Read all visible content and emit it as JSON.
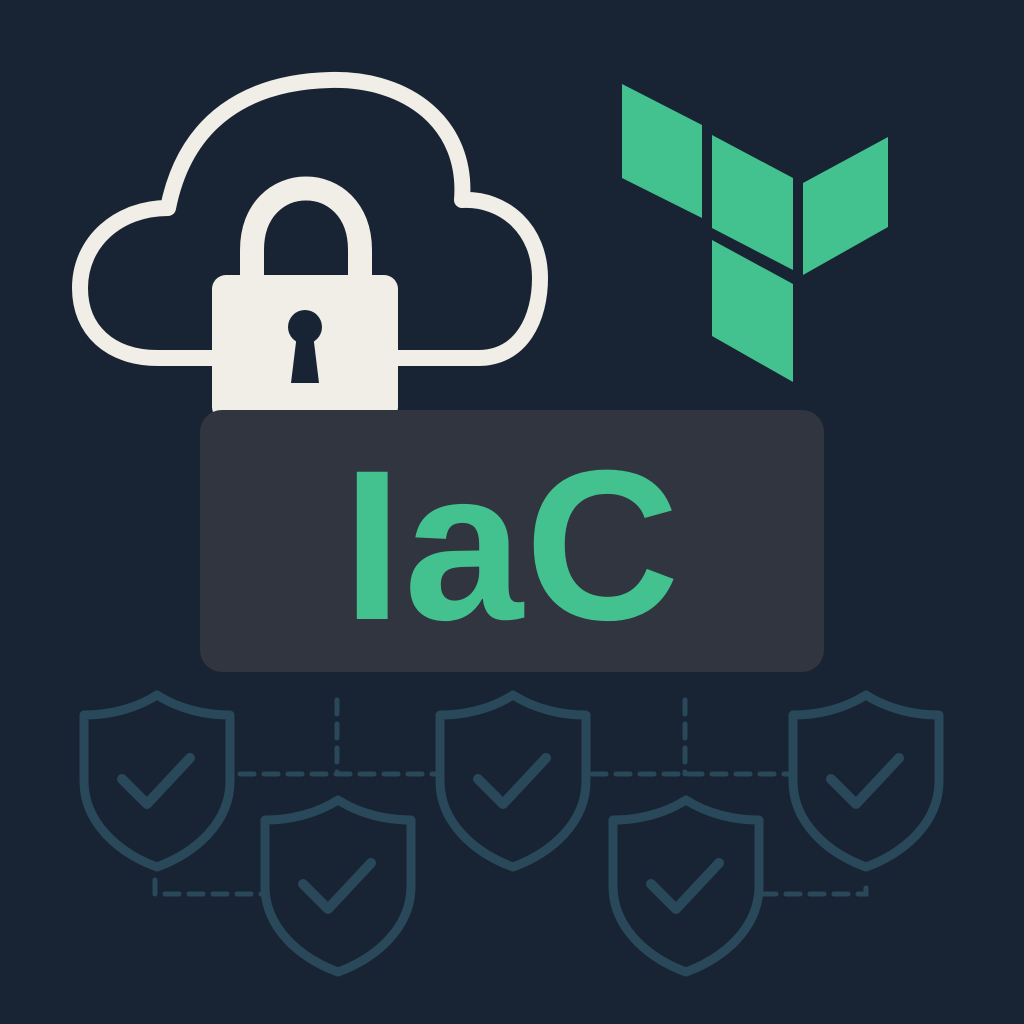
{
  "title": "IaC",
  "colors": {
    "background": "#182433",
    "label_box": "#30353f",
    "accent": "#43c18f",
    "cloud_lock": "#f0eee6",
    "shield": "#29495a",
    "keyhole": "#182433"
  },
  "icons": {
    "cloud": "cloud-icon",
    "lock": "padlock-icon",
    "logo": "terraform-logo",
    "shields": [
      "shield-check-icon",
      "shield-check-icon",
      "shield-check-icon",
      "shield-check-icon",
      "shield-check-icon"
    ]
  }
}
